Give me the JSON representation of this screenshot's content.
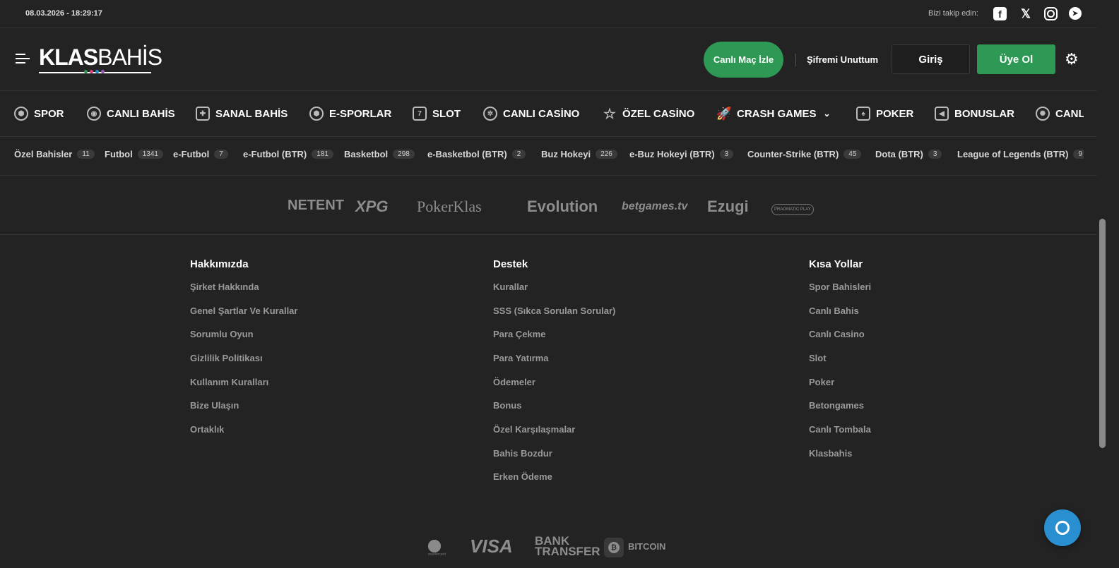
{
  "topbar": {
    "datetime": "08.03.2026 - 18:29:17",
    "follow_label": "Bizi takip edin:",
    "social": [
      "facebook-icon",
      "x-icon",
      "instagram-icon",
      "telegram-icon"
    ]
  },
  "header": {
    "logo_bold": "KLAS",
    "logo_light": "BAHİS",
    "live_button": "Canlı Maç İzle",
    "forgot_password": "Şifremi Unuttum",
    "login_button": "Giriş",
    "register_button": "Üye Ol",
    "colors": {
      "accent": "#2e9955",
      "background": "#232323",
      "chat": "#2a8fd0"
    }
  },
  "nav": {
    "items": [
      {
        "label": "SPOR",
        "icon": "soccer-ball-icon"
      },
      {
        "label": "CANLI BAHİS",
        "icon": "live-broadcast-icon"
      },
      {
        "label": "SANAL BAHİS",
        "icon": "gamepad-icon"
      },
      {
        "label": "E-SPORLAR",
        "icon": "esports-icon"
      },
      {
        "label": "SLOT",
        "icon": "slot-machine-icon"
      },
      {
        "label": "CANLI CASİNO",
        "icon": "casino-chip-icon"
      },
      {
        "label": "ÖZEL CASİNO",
        "icon": "star-icon"
      },
      {
        "label": "CRASH GAMES",
        "icon": "rocket-icon"
      },
      {
        "label": "POKER",
        "icon": "cards-icon"
      },
      {
        "label": "BONUSLAR",
        "icon": "megaphone-icon"
      },
      {
        "label": "CANL",
        "icon": "ferris-wheel-icon"
      }
    ]
  },
  "subnav": {
    "items": [
      {
        "label": "Özel Bahisler",
        "count": "11"
      },
      {
        "label": "Futbol",
        "count": "1341"
      },
      {
        "label": "e-Futbol",
        "count": "7"
      },
      {
        "label": "e-Futbol (BTR)",
        "count": "181"
      },
      {
        "label": "Basketbol",
        "count": "298"
      },
      {
        "label": "e-Basketbol (BTR)",
        "count": "2"
      },
      {
        "label": "Buz Hokeyi",
        "count": "226"
      },
      {
        "label": "e-Buz Hokeyi (BTR)",
        "count": "3"
      },
      {
        "label": "Counter-Strike (BTR)",
        "count": "45"
      },
      {
        "label": "Dota (BTR)",
        "count": "3"
      },
      {
        "label": "League of Legends (BTR)",
        "count": "9"
      }
    ]
  },
  "providers": [
    "NETENT",
    "XPG",
    "PokerKlas",
    "Evolution",
    "betgames.tv",
    "Ezugi",
    "PRAGMATIC PLAY"
  ],
  "footer": {
    "col1": {
      "title": "Hakkımızda",
      "links": [
        "Şirket Hakkında",
        "Genel Şartlar Ve Kurallar",
        "Sorumlu Oyun",
        "Gizlilik Politikası",
        "Kullanım Kuralları",
        "Bize Ulaşın",
        "Ortaklık"
      ]
    },
    "col2": {
      "title": "Destek",
      "links": [
        "Kurallar",
        "SSS (Sıkca Sorulan Sorular)",
        "Para Çekme",
        "Para Yatırma",
        "Ödemeler",
        "Bonus",
        "Özel Karşılaşmalar",
        "Bahis Bozdur",
        "Erken Ödeme"
      ]
    },
    "col3": {
      "title": "Kısa Yollar",
      "links": [
        "Spor Bahisleri",
        "Canlı Bahis",
        "Canlı Casino",
        "Slot",
        "Poker",
        "Betongames",
        "Canlı Tombala",
        "Klasbahis"
      ]
    }
  },
  "payments": {
    "mastercard_small": "mastercard",
    "visa": "VISA",
    "bank_line1": "BANK",
    "bank_line2": "TRANSFER",
    "bitcoin": "BITCOIN"
  }
}
